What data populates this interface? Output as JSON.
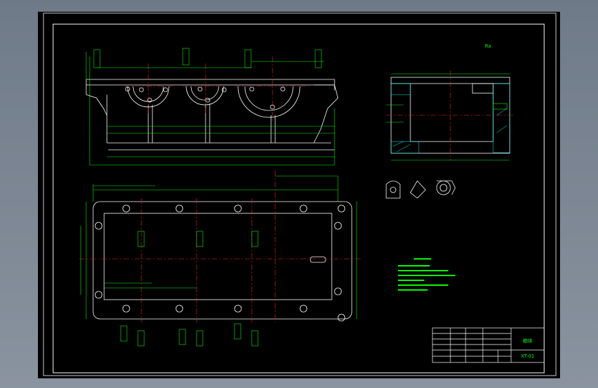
{
  "viewport": {
    "background": "#7d8694",
    "sheet_background": "#000000"
  },
  "colors": {
    "frame": "#ffffff",
    "geometry": "#ffffff",
    "dimension": "#00ff00",
    "centerline": "#ff2020",
    "hatch": "#00ffff",
    "text": "#00ff00"
  },
  "labels": {
    "roughness_symbol": "Ra",
    "title_block_name": "箱体",
    "title_block_code": "XT-01"
  }
}
